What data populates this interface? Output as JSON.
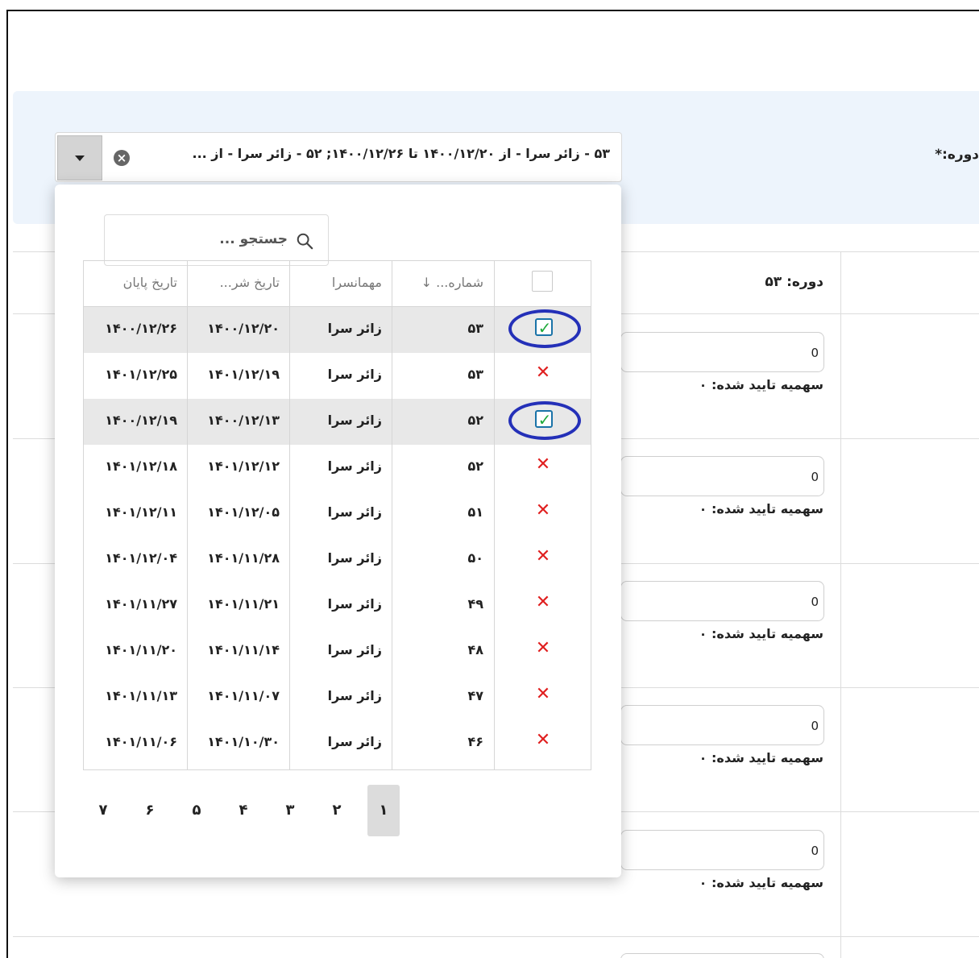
{
  "form": {
    "period_label": "دوره:*",
    "selected_value": "۵۳ - زائر سرا - از ۱۴۰۰/۱۲/۲۰ تا ۱۴۰۰/۱۲/۲۶; ۵۲ - زائر سرا - از ...",
    "clear_glyph": "×"
  },
  "dropdown": {
    "search_placeholder": "جستجو ...",
    "columns": {
      "number": "شماره... ↓",
      "guesthouse": "مهمانسرا",
      "start_date": "تاریخ شر...",
      "end_date": "تاریخ پایان"
    },
    "rows": [
      {
        "selected": true,
        "number": "۵۳",
        "guesthouse": "زائر سرا",
        "start": "۱۴۰۰/۱۲/۲۰",
        "end": "۱۴۰۰/۱۲/۲۶"
      },
      {
        "selected": false,
        "number": "۵۳",
        "guesthouse": "زائر سرا",
        "start": "۱۴۰۱/۱۲/۱۹",
        "end": "۱۴۰۱/۱۲/۲۵"
      },
      {
        "selected": true,
        "number": "۵۲",
        "guesthouse": "زائر سرا",
        "start": "۱۴۰۰/۱۲/۱۳",
        "end": "۱۴۰۰/۱۲/۱۹"
      },
      {
        "selected": false,
        "number": "۵۲",
        "guesthouse": "زائر سرا",
        "start": "۱۴۰۱/۱۲/۱۲",
        "end": "۱۴۰۱/۱۲/۱۸"
      },
      {
        "selected": false,
        "number": "۵۱",
        "guesthouse": "زائر سرا",
        "start": "۱۴۰۱/۱۲/۰۵",
        "end": "۱۴۰۱/۱۲/۱۱"
      },
      {
        "selected": false,
        "number": "۵۰",
        "guesthouse": "زائر سرا",
        "start": "۱۴۰۱/۱۱/۲۸",
        "end": "۱۴۰۱/۱۲/۰۴"
      },
      {
        "selected": false,
        "number": "۴۹",
        "guesthouse": "زائر سرا",
        "start": "۱۴۰۱/۱۱/۲۱",
        "end": "۱۴۰۱/۱۱/۲۷"
      },
      {
        "selected": false,
        "number": "۴۸",
        "guesthouse": "زائر سرا",
        "start": "۱۴۰۱/۱۱/۱۴",
        "end": "۱۴۰۱/۱۱/۲۰"
      },
      {
        "selected": false,
        "number": "۴۷",
        "guesthouse": "زائر سرا",
        "start": "۱۴۰۱/۱۱/۰۷",
        "end": "۱۴۰۱/۱۱/۱۳"
      },
      {
        "selected": false,
        "number": "۴۶",
        "guesthouse": "زائر سرا",
        "start": "۱۴۰۱/۱۰/۳۰",
        "end": "۱۴۰۱/۱۱/۰۶"
      }
    ],
    "pages": [
      "۱",
      "۲",
      "۳",
      "۴",
      "۵",
      "۶",
      "۷"
    ],
    "active_page": "۱"
  },
  "period_table": {
    "header": "دوره: ۵۳",
    "rows": [
      {
        "input_value": "0",
        "quota_label": "سهمیه تایید شده: ۰"
      },
      {
        "input_value": "0",
        "quota_label": "سهمیه تایید شده: ۰"
      },
      {
        "input_value": "0",
        "quota_label": "سهمیه تایید شده: ۰"
      },
      {
        "input_value": "0",
        "quota_label": "سهمیه تایید شده: ۰"
      },
      {
        "input_value": "0",
        "quota_label": "سهمیه تایید شده: ۰"
      }
    ]
  },
  "colors": {
    "band": "#edf4fc",
    "annotation_circle": "#2430b8",
    "check_green": "#1faa3c",
    "cross_red": "#e02020"
  },
  "icons": {
    "selected_mark": "check-icon",
    "unselected_mark": "close-icon",
    "search": "search-icon"
  }
}
